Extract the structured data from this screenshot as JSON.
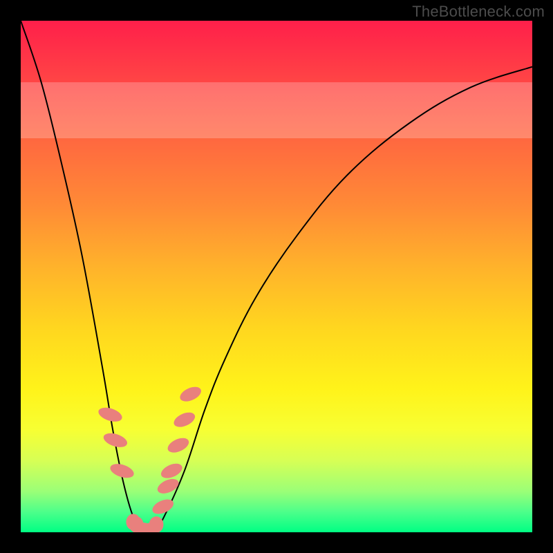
{
  "watermark": "TheBottleneck.com",
  "colors": {
    "frame": "#000000",
    "bead": "#e9807d",
    "curve": "#000000",
    "gradient_top": "#ff1f4a",
    "gradient_bottom": "#00ff84"
  },
  "chart_data": {
    "type": "line",
    "title": "",
    "xlabel": "",
    "ylabel": "",
    "xlim": [
      0,
      100
    ],
    "ylim": [
      0,
      100
    ],
    "series": [
      {
        "name": "bottleneck-curve",
        "x": [
          0,
          4,
          8,
          12,
          16,
          18,
          20,
          22,
          24,
          26,
          28,
          32,
          36,
          40,
          46,
          54,
          64,
          76,
          88,
          100
        ],
        "y": [
          100,
          88,
          72,
          54,
          32,
          20,
          10,
          3,
          0,
          0,
          3,
          12,
          24,
          34,
          46,
          58,
          70,
          80,
          87,
          91
        ]
      }
    ],
    "markers": {
      "name": "data-beads",
      "x": [
        17.5,
        18.5,
        19.8,
        22.0,
        22.6,
        24.0,
        25.5,
        26.5,
        27.8,
        28.8,
        29.5,
        30.8,
        32.0,
        33.2
      ],
      "y": [
        23,
        18,
        12,
        2,
        1.5,
        0.5,
        0.5,
        1.5,
        5,
        9,
        12,
        17,
        22,
        27
      ],
      "rx": [
        1.2,
        1.2,
        1.2,
        1.4,
        1.4,
        1.6,
        1.6,
        1.4,
        1.2,
        1.2,
        1.2,
        1.2,
        1.2,
        1.2
      ],
      "ry": [
        2.4,
        2.4,
        2.4,
        1.6,
        1.6,
        1.4,
        1.4,
        1.6,
        2.2,
        2.2,
        2.2,
        2.2,
        2.2,
        2.2
      ]
    },
    "pale_band": {
      "y0": 77,
      "y1": 88
    }
  }
}
